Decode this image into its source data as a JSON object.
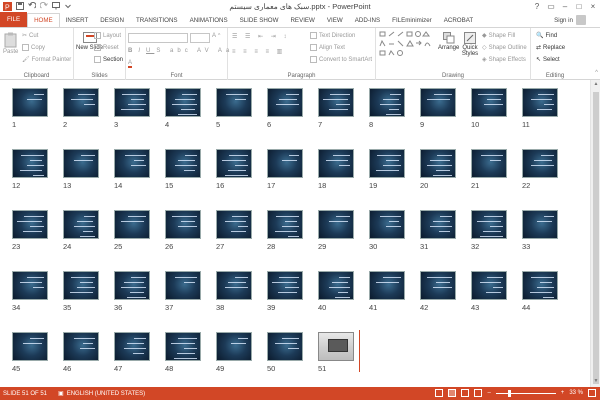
{
  "app": {
    "window_title": "سبک های معماری سیستم.pptx - PowerPoint",
    "sign_in": "Sign in"
  },
  "tabs": [
    "FILE",
    "HOME",
    "INSERT",
    "DESIGN",
    "TRANSITIONS",
    "ANIMATIONS",
    "SLIDE SHOW",
    "REVIEW",
    "VIEW",
    "ADD-INS",
    "FILEminimizer",
    "ACROBAT"
  ],
  "ribbon": {
    "clipboard": {
      "label": "Clipboard",
      "paste": "Paste",
      "cut": "Cut",
      "copy": "Copy",
      "format_painter": "Format Painter"
    },
    "slides": {
      "label": "Slides",
      "new_slide": "New Slide",
      "layout": "Layout",
      "reset": "Reset",
      "section": "Section"
    },
    "font": {
      "label": "Font"
    },
    "paragraph": {
      "label": "Paragraph",
      "text_direction": "Text Direction",
      "align_text": "Align Text",
      "convert_smartart": "Convert to SmartArt"
    },
    "drawing": {
      "label": "Drawing",
      "arrange": "Arrange",
      "quick_styles": "Quick Styles",
      "shape_fill": "Shape Fill",
      "shape_outline": "Shape Outline",
      "shape_effects": "Shape Effects"
    },
    "editing": {
      "label": "Editing",
      "find": "Find",
      "replace": "Replace",
      "select": "Select"
    }
  },
  "slides": [
    "1",
    "2",
    "3",
    "4",
    "5",
    "6",
    "7",
    "8",
    "9",
    "10",
    "11",
    "12",
    "13",
    "14",
    "15",
    "16",
    "17",
    "18",
    "19",
    "20",
    "21",
    "22",
    "23",
    "24",
    "25",
    "26",
    "27",
    "28",
    "29",
    "30",
    "31",
    "32",
    "33",
    "34",
    "35",
    "36",
    "37",
    "38",
    "39",
    "40",
    "41",
    "42",
    "43",
    "44",
    "45",
    "46",
    "47",
    "48",
    "49",
    "50",
    "51"
  ],
  "status": {
    "slide_count": "SLIDE 51 OF 51",
    "language": "ENGLISH (UNITED STATES)",
    "zoom": "33 %"
  },
  "colors": {
    "accent": "#d24726"
  }
}
